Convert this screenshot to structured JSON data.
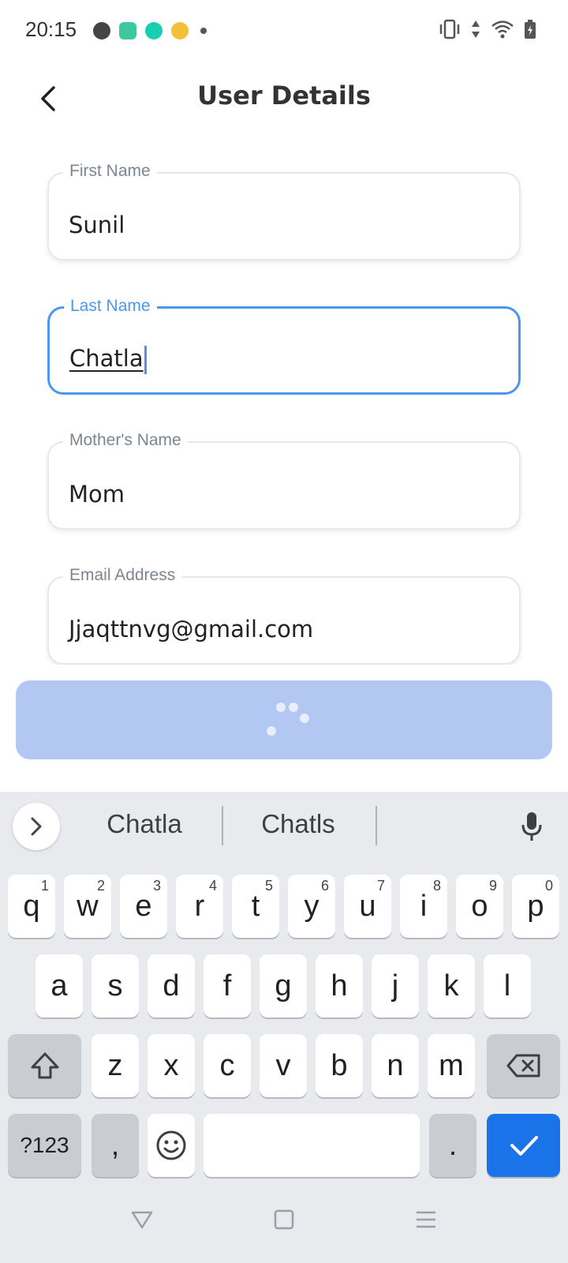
{
  "status_bar": {
    "time": "20:15"
  },
  "header": {
    "title": "User Details"
  },
  "form": {
    "first_name": {
      "label": "First Name",
      "value": "Sunil"
    },
    "last_name": {
      "label": "Last Name",
      "value": "Chatla"
    },
    "mothers_name": {
      "label": "Mother's Name",
      "value": "Mom"
    },
    "email": {
      "label": "Email Address",
      "value": "Jjaqttnvg@gmail.com"
    }
  },
  "colors": {
    "focus": "#4a98ee",
    "button_disabled": "#b2c8f2",
    "keyboard_bg": "#e8eaed",
    "action_key": "#1a73e8"
  },
  "keyboard": {
    "suggestions": [
      "Chatla",
      "Chatls"
    ],
    "row1": [
      {
        "k": "q",
        "h": "1"
      },
      {
        "k": "w",
        "h": "2"
      },
      {
        "k": "e",
        "h": "3"
      },
      {
        "k": "r",
        "h": "4"
      },
      {
        "k": "t",
        "h": "5"
      },
      {
        "k": "y",
        "h": "6"
      },
      {
        "k": "u",
        "h": "7"
      },
      {
        "k": "i",
        "h": "8"
      },
      {
        "k": "o",
        "h": "9"
      },
      {
        "k": "p",
        "h": "0"
      }
    ],
    "row2": [
      "a",
      "s",
      "d",
      "f",
      "g",
      "h",
      "j",
      "k",
      "l"
    ],
    "row3": [
      "z",
      "x",
      "c",
      "v",
      "b",
      "n",
      "m"
    ],
    "symbols_label": "?123",
    "comma_label": ",",
    "period_label": "."
  }
}
